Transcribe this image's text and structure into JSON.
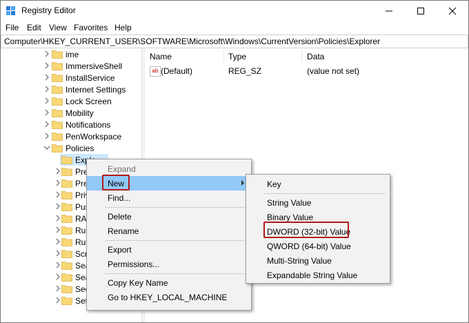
{
  "window": {
    "title": "Registry Editor",
    "menu": [
      "File",
      "Edit",
      "View",
      "Favorites",
      "Help"
    ],
    "address": "Computer\\HKEY_CURRENT_USER\\SOFTWARE\\Microsoft\\Windows\\CurrentVersion\\Policies\\Explorer"
  },
  "tree": {
    "items": [
      {
        "label": "ime",
        "expanded": false
      },
      {
        "label": "ImmersiveShell",
        "expanded": false
      },
      {
        "label": "InstallService",
        "expanded": false
      },
      {
        "label": "Internet Settings",
        "expanded": false
      },
      {
        "label": "Lock Screen",
        "expanded": false
      },
      {
        "label": "Mobility",
        "expanded": false
      },
      {
        "label": "Notifications",
        "expanded": false
      },
      {
        "label": "PenWorkspace",
        "expanded": false
      },
      {
        "label": "Policies",
        "expanded": true
      },
      {
        "label": "Explo",
        "selected": true
      },
      {
        "label": "Precis"
      },
      {
        "label": "Prelau"
      },
      {
        "label": "Privac"
      },
      {
        "label": "PushN"
      },
      {
        "label": "RADA"
      },
      {
        "label": "Run"
      },
      {
        "label": "RunO"
      },
      {
        "label": "Scree"
      },
      {
        "label": "Searc"
      },
      {
        "label": "Searc"
      },
      {
        "label": "Secur"
      },
      {
        "label": "Settin"
      }
    ]
  },
  "list": {
    "columns": [
      "Name",
      "Type",
      "Data"
    ],
    "rows": [
      {
        "name": "(Default)",
        "type": "REG_SZ",
        "data": "(value not set)"
      }
    ]
  },
  "context_menu": {
    "items": [
      {
        "label": "Expand",
        "disabled": true
      },
      {
        "label": "New",
        "submenu": true,
        "highlighted": true
      },
      {
        "label": "Find..."
      },
      {
        "label": "Delete"
      },
      {
        "label": "Rename"
      },
      {
        "label": "Export"
      },
      {
        "label": "Permissions..."
      },
      {
        "label": "Copy Key Name"
      },
      {
        "label": "Go to HKEY_LOCAL_MACHINE"
      }
    ]
  },
  "submenu": {
    "items": [
      {
        "label": "Key"
      },
      {
        "label": "String Value"
      },
      {
        "label": "Binary Value"
      },
      {
        "label": "DWORD (32-bit) Value",
        "highlighted": true
      },
      {
        "label": "QWORD (64-bit) Value"
      },
      {
        "label": "Multi-String Value"
      },
      {
        "label": "Expandable String Value"
      }
    ]
  },
  "colors": {
    "selection": "#cce8ff",
    "menu_hover": "#91c9f7",
    "highlight_box": "#b01818",
    "folder": "#f8d775"
  }
}
